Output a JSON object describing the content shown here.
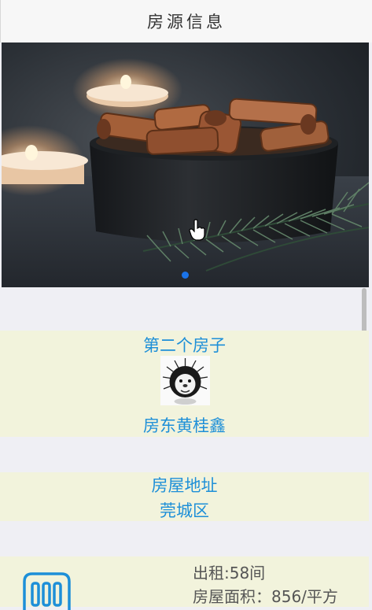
{
  "header": {
    "title": "房源信息"
  },
  "carousel": {
    "slide_count": 1,
    "active_index": 0,
    "accent_color": "#1a73e8"
  },
  "listing": {
    "name": "第二个房子",
    "landlord": "房东黄桂鑫"
  },
  "address": {
    "label": "房屋地址",
    "value": "莞城区"
  },
  "details": {
    "rent": "出租:58间",
    "area": "房屋面积：856/平方"
  },
  "colors": {
    "card_bg": "#f2f3dc",
    "link_blue": "#1d8fd8",
    "page_bg": "#efeff4"
  }
}
